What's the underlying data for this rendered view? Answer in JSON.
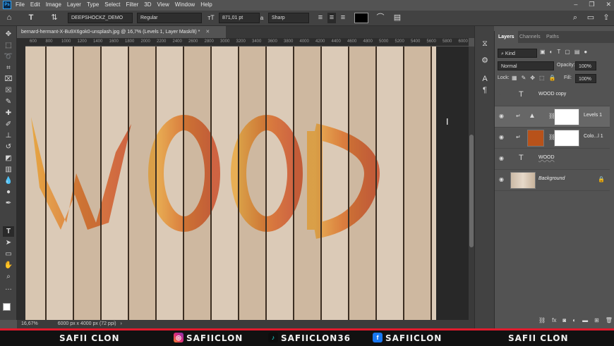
{
  "menubar": {
    "logo": "Ps",
    "items": [
      "File",
      "Edit",
      "Image",
      "Layer",
      "Type",
      "Select",
      "Filter",
      "3D",
      "View",
      "Window",
      "Help"
    ],
    "window_controls": [
      "–",
      "❐",
      "✕"
    ]
  },
  "options_bar": {
    "font_family": "DEEPSHOCKZ_DEMO",
    "font_style": "Regular",
    "font_size": "871,01 pt",
    "anti_alias_label": "a",
    "anti_alias": "Sharp",
    "text_color": "#000000"
  },
  "document": {
    "tab_title": "bernard-hermant-X-Bu9X6gok0-unsplash.jpg @ 16,7% (Levels 1, Layer Mask/8) *",
    "ruler_top": [
      "600",
      "800",
      "1000",
      "1200",
      "1400",
      "1600",
      "1800",
      "2000",
      "2200",
      "2400",
      "2600",
      "2800",
      "3000",
      "3200",
      "3400",
      "3600",
      "3800",
      "4000",
      "4200",
      "4400",
      "4600",
      "4800",
      "5000",
      "5200",
      "5400",
      "5600",
      "5800",
      "6000"
    ],
    "canvas_text": "WOOD",
    "status_zoom": "16,67%",
    "status_info": "6000 px x 4000 px (72 ppi)"
  },
  "layers_panel": {
    "tabs": [
      "Layers",
      "Channels",
      "Paths"
    ],
    "kind_label": "Kind",
    "blend_mode": "Normal",
    "opacity_label": "Opacity:",
    "opacity_value": "100%",
    "lock_label": "Lock:",
    "fill_label": "Fill:",
    "fill_value": "100%",
    "layers": [
      {
        "name": "WOOD copy",
        "type": "text",
        "visible": false
      },
      {
        "name": "Levels 1",
        "type": "adjustment",
        "visible": true
      },
      {
        "name": "Colo...l 1",
        "type": "fill",
        "visible": true,
        "swatch": "#b8521a"
      },
      {
        "name": "WOOD",
        "type": "text",
        "visible": true
      },
      {
        "name": "Background",
        "type": "image",
        "visible": true
      }
    ],
    "footer_icons": [
      "link-icon",
      "fx-icon",
      "mask-icon",
      "adjustment-icon",
      "folder-icon",
      "new-layer-icon",
      "trash-icon"
    ]
  },
  "social_bar": {
    "left_name": "SAFII CLON",
    "instagram": "SAFIICLON",
    "tiktok": "SAFIICLON36",
    "facebook": "SAFIICLON",
    "right_name": "SAFII CLON"
  },
  "colors": {
    "accent_red": "#e11b2d",
    "photoshop_blue": "#31a8ff",
    "wood_text_orange": "#d7691f"
  }
}
